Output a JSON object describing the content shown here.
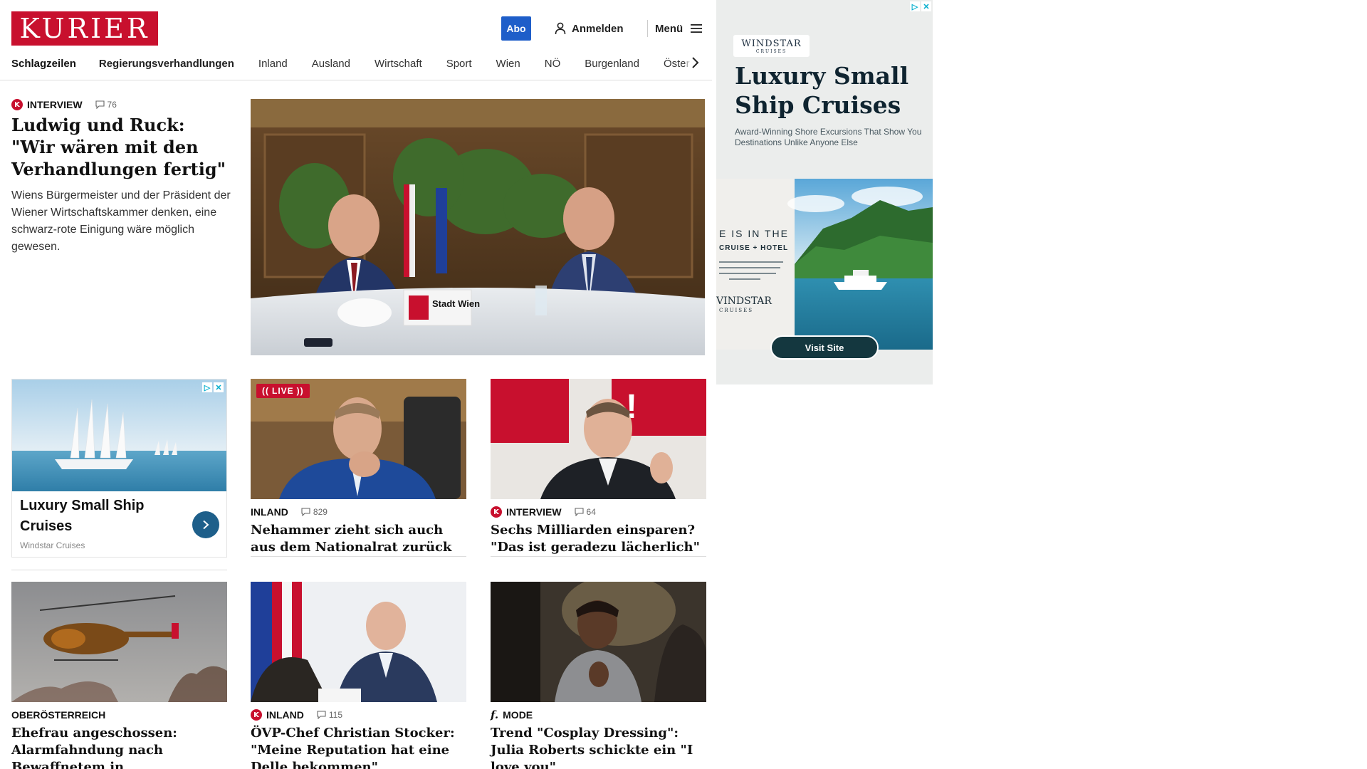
{
  "header": {
    "logo": "KURIER",
    "abo_label": "Abo",
    "login_label": "Anmelden",
    "menu_label": "Menü",
    "brand_color": "#c8102e",
    "accent_color": "#1e5ec9"
  },
  "nav": {
    "items": [
      "Schlagzeilen",
      "Regierungsverhandlungen",
      "Inland",
      "Ausland",
      "Wirtschaft",
      "Sport",
      "Wien",
      "NÖ",
      "Burgenland",
      "Öster"
    ]
  },
  "hero": {
    "kicker": "INTERVIEW",
    "comments": "76",
    "title": "Ludwig und Ruck: \"Wir wären mit den Verhand­lungen fertig\"",
    "lead": "Wiens Bürgermeister und der Präsident der Wiener Wirtschaftskammer denken, eine schwarz-rote Einigung wäre möglich gewesen.",
    "image_sign": "Stadt Wien"
  },
  "feed_ad": {
    "title": "Luxury Small Ship Cruises",
    "source": "Windstar Cruises",
    "adchoices": [
      "▷",
      "✕"
    ]
  },
  "cards": [
    {
      "live": "LIVE",
      "kicker": "INLAND",
      "comments": "829",
      "title": "Nehammer zieht sich auch aus dem Nationalrat zurück"
    },
    {
      "badge": "K",
      "kicker": "INTERVIEW",
      "comments": "64",
      "title": "Sechs Milliarden einsparen? \"Das ist geradezu lächerlich\""
    },
    {
      "kicker": "OBERÖSTERREICH",
      "title": "Ehefrau angeschossen: Alarmfahn­dung nach Bewaffnetem in Oberösterreich"
    },
    {
      "badge": "K",
      "kicker": "INLAND",
      "comments": "115",
      "title": "ÖVP-Chef Christian Stocker: \"Meine Reputation hat eine Delle bekommen\""
    },
    {
      "badge": "f.",
      "kicker": "MODE",
      "title": "Trend \"Cosplay Dressing\": Julia Roberts schickte ein \"I love you\""
    }
  ],
  "side_ad": {
    "logo_top": "WINDSTAR",
    "logo_bottom": "CRUISES",
    "headline": "Luxury Small Ship Cruises",
    "sub": "Award-Winning Shore Excursions That Show You Destinations Unlike Anyone Else",
    "scene_line1": "E IS IN THE",
    "scene_line2": "CRUISE + HOTEL",
    "scene_logo": "VINDSTAR",
    "scene_logo_sub": "CRUISES",
    "visit": "Visit Site",
    "adchoices": [
      "▷",
      "✕"
    ]
  }
}
